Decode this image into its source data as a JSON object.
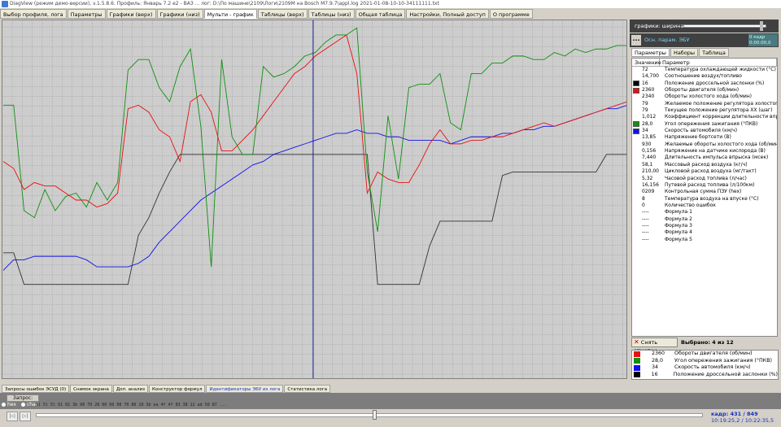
{
  "window": {
    "title": "DiagView (режим демо-версии), v.1.5.8.6. Профиль: Январь 7.2 е2 - ВАЗ ... лог: D:\\По машине\\2109\\Логи\\2109М на Bosch M7.9.7\\appl.log 2021-01-08-10-10-34111111.txt"
  },
  "top_tabs": [
    "Выбор профиля, лога",
    "Параметры",
    "Графики (верх)",
    "Графики (низ)",
    "Мульти - график",
    "Таблицы (верх)",
    "Таблицы (низ)",
    "Общая таблица",
    "Настройки, Полный доступ",
    "О программе"
  ],
  "active_top_tab": 4,
  "right": {
    "graph_label": "графики:  ширина:",
    "info_btn": "...",
    "info_label": "Осн. парам. ЭБУ",
    "counter_line1": "0 кадр",
    "counter_line2": "0:00:00,0",
    "sub_tabs": [
      "Параметры",
      "Наборы",
      "Таблица"
    ],
    "col_value": "Значение",
    "col_param": "Параметр",
    "params": [
      {
        "color": "",
        "value": "72",
        "name": "Температура охлаждающей жидкости (°C)"
      },
      {
        "color": "",
        "value": "14,700",
        "name": "Соотношение воздух/топливо"
      },
      {
        "color": "#000000",
        "value": "16",
        "name": "Положение дроссельной заслонки (%)"
      },
      {
        "color": "#e81010",
        "value": "2360",
        "name": "Обороты двигателя (об/мин)"
      },
      {
        "color": "",
        "value": "2340",
        "name": "Обороты холостого хода (об/мин)"
      },
      {
        "color": "",
        "value": "79",
        "name": "Желаемое положение регулятора холостог..."
      },
      {
        "color": "",
        "value": "79",
        "name": "Текущее положение регулятора ХХ (шаг)"
      },
      {
        "color": "",
        "value": "1,012",
        "name": "Коэффициент коррекции длительности впр..."
      },
      {
        "color": "#109010",
        "value": "28,0",
        "name": "Угол опережения зажигания (°ПКВ)"
      },
      {
        "color": "#1010e8",
        "value": "34",
        "name": "Скорость автомобиля (км/ч)"
      },
      {
        "color": "",
        "value": "13,85",
        "name": "Напряжение бортсети (В)"
      },
      {
        "color": "",
        "value": "930",
        "name": "Желаемые обороты холостого хода (об/мин)"
      },
      {
        "color": "",
        "value": "0,156",
        "name": "Напряжение на датчике кислорода (В)"
      },
      {
        "color": "",
        "value": "7,440",
        "name": "Длительность импульса впрыска (мсек)"
      },
      {
        "color": "",
        "value": "58,1",
        "name": "Массовый расход воздуха (кг/ч)"
      },
      {
        "color": "",
        "value": "210,00",
        "name": "Цикловой расход воздуха (мг/такт)"
      },
      {
        "color": "",
        "value": "5,32",
        "name": "Часовой расход топлива (л/час)"
      },
      {
        "color": "",
        "value": "16,156",
        "name": "Путевой расход топлива (л/100км)"
      },
      {
        "color": "",
        "value": "0209",
        "name": "Контрольная сумма ПЗУ (hex)"
      },
      {
        "color": "",
        "value": "8",
        "name": "Температура воздуха на впуске (°C)"
      },
      {
        "color": "",
        "value": "0",
        "name": "Количество ошибок"
      },
      {
        "color": "",
        "value": "----",
        "name": "Формула 1"
      },
      {
        "color": "",
        "value": "----",
        "name": "Формула 2"
      },
      {
        "color": "",
        "value": "----",
        "name": "Формула 3"
      },
      {
        "color": "",
        "value": "----",
        "name": "Формула 4"
      },
      {
        "color": "",
        "value": "----",
        "name": "Формула 5"
      }
    ],
    "clear_label": "Снять отметки",
    "selected_label": "Выбрано: 4 из 12"
  },
  "legend": [
    {
      "color": "#e81010",
      "value": "2360",
      "name": "Обороты двигателя (об/мин)"
    },
    {
      "color": "#109010",
      "value": "28,0",
      "name": "Угол опережения зажигания (°ПКВ)"
    },
    {
      "color": "#1010e8",
      "value": "34",
      "name": "Скорость автомобиля (км/ч)"
    },
    {
      "color": "#000000",
      "value": "16",
      "name": "Положение дроссельной заслонки (%)"
    }
  ],
  "bottom_tabs": [
    "Запросы ошибок ЭСУД (0)",
    "Снимок экрана",
    "Доп. анализ",
    "Конструктор формул",
    "Идентификаторы ЭБУ из лога",
    "Статистика лога"
  ],
  "highlight_bottom_tab": 4,
  "request": {
    "button": "Запрос:",
    "radio_hex": "hex",
    "radio_char": "char",
    "hex_line": "5l 5l 5l 61 01 3b 90 70 28 00 00 00 70 80 10 3b ea 4f 4f 83 38 22 ad 50 87 ..."
  },
  "nav": {
    "btn1": "|◁",
    "btn2": "▷|"
  },
  "frame": {
    "label": "кадр: 431 / 849",
    "time": "10:19:25,2 / 10:22:35,5"
  },
  "cursor_frame": 431,
  "chart_data": {
    "type": "line",
    "x_range": [
      0,
      60
    ],
    "y_range": [
      0,
      100
    ],
    "cursor_x": 29.8,
    "series": [
      {
        "name": "Угол опережения зажигания (°ПКВ)",
        "color": "#109010",
        "x": [
          0,
          1,
          2,
          3,
          4,
          5,
          6,
          7,
          8,
          9,
          10,
          11,
          12,
          13,
          14,
          15,
          16,
          17,
          18,
          19,
          20,
          21,
          22,
          23,
          24,
          25,
          26,
          27,
          28,
          29,
          30,
          31,
          32,
          33,
          34,
          35,
          36,
          37,
          38,
          39,
          40,
          41,
          42,
          43,
          44,
          45,
          46,
          47,
          48,
          49,
          50,
          51,
          52,
          53,
          54,
          55,
          56,
          57,
          58,
          59,
          60
        ],
        "y": [
          77,
          77,
          47,
          45,
          53,
          47,
          51,
          52,
          48,
          55,
          50,
          55,
          87,
          90,
          90,
          82,
          78,
          88,
          93,
          71,
          31,
          90,
          68,
          63,
          63,
          88,
          85,
          86,
          88,
          91,
          92,
          95,
          97,
          97,
          99,
          58,
          41,
          74,
          56,
          82,
          83,
          83,
          86,
          72,
          70,
          86,
          86,
          89,
          89,
          91,
          91,
          90,
          90,
          92,
          91,
          93,
          92,
          93,
          93,
          94,
          94
        ]
      },
      {
        "name": "Обороты двигателя (об/мин)",
        "color": "#e81010",
        "x": [
          0,
          1,
          2,
          3,
          4,
          5,
          6,
          7,
          8,
          9,
          10,
          11,
          12,
          13,
          14,
          15,
          16,
          17,
          18,
          19,
          20,
          21,
          22,
          23,
          24,
          25,
          26,
          27,
          28,
          29,
          30,
          31,
          32,
          33,
          34,
          35,
          36,
          37,
          38,
          39,
          40,
          41,
          42,
          43,
          44,
          45,
          46,
          47,
          48,
          49,
          50,
          51,
          52,
          53,
          54,
          55,
          56,
          57,
          58,
          59,
          60
        ],
        "y": [
          61,
          59,
          53,
          55,
          54,
          54,
          52,
          50,
          50,
          48,
          49,
          52,
          76,
          77,
          75,
          70,
          68,
          61,
          78,
          80,
          75,
          64,
          64,
          67,
          70,
          74,
          78,
          82,
          86,
          88,
          91,
          93,
          95,
          97,
          86,
          52,
          58,
          56,
          55,
          55,
          60,
          66,
          70,
          66,
          66,
          67,
          67,
          68,
          68,
          69,
          70,
          71,
          72,
          71,
          72,
          73,
          74,
          75,
          76,
          77,
          78
        ]
      },
      {
        "name": "Скорость автомобиля (км/ч)",
        "color": "#1010e8",
        "x": [
          0,
          1,
          2,
          3,
          4,
          5,
          6,
          7,
          8,
          9,
          10,
          11,
          12,
          13,
          14,
          15,
          16,
          17,
          18,
          19,
          20,
          21,
          22,
          23,
          24,
          25,
          26,
          27,
          28,
          29,
          30,
          31,
          32,
          33,
          34,
          35,
          36,
          37,
          38,
          39,
          40,
          41,
          42,
          43,
          44,
          45,
          46,
          47,
          48,
          49,
          50,
          51,
          52,
          53,
          54,
          55,
          56,
          57,
          58,
          59,
          60
        ],
        "y": [
          30,
          33,
          33,
          34,
          34,
          34,
          34,
          34,
          33,
          31,
          31,
          31,
          31,
          32,
          34,
          38,
          41,
          44,
          47,
          50,
          52,
          54,
          56,
          58,
          60,
          61,
          63,
          64,
          65,
          66,
          67,
          68,
          69,
          69,
          70,
          69,
          69,
          68,
          68,
          67,
          67,
          67,
          67,
          66,
          67,
          68,
          68,
          68,
          69,
          69,
          70,
          70,
          71,
          71,
          72,
          73,
          74,
          75,
          76,
          76,
          77
        ]
      },
      {
        "name": "Положение дроссельной заслонки (%)",
        "color": "#333333",
        "x": [
          0,
          1,
          2,
          3,
          4,
          5,
          6,
          7,
          8,
          9,
          10,
          11,
          12,
          13,
          14,
          15,
          16,
          17,
          18,
          19,
          20,
          21,
          22,
          23,
          24,
          25,
          26,
          27,
          28,
          29,
          30,
          31,
          32,
          33,
          34,
          35,
          36,
          37,
          38,
          39,
          40,
          41,
          42,
          43,
          44,
          45,
          46,
          47,
          48,
          49,
          50,
          51,
          52,
          53,
          54,
          55,
          56,
          57,
          58,
          59,
          60
        ],
        "y": [
          35,
          35,
          26,
          26,
          26,
          26,
          26,
          26,
          26,
          26,
          26,
          26,
          26,
          40,
          45,
          52,
          58,
          63,
          63,
          63,
          63,
          63,
          63,
          63,
          63,
          63,
          63,
          63,
          63,
          63,
          63,
          63,
          63,
          63,
          63,
          63,
          26,
          26,
          26,
          26,
          26,
          37,
          44,
          44,
          44,
          44,
          44,
          44,
          57,
          58,
          58,
          58,
          58,
          58,
          58,
          58,
          58,
          58,
          63,
          63,
          63
        ]
      }
    ]
  }
}
